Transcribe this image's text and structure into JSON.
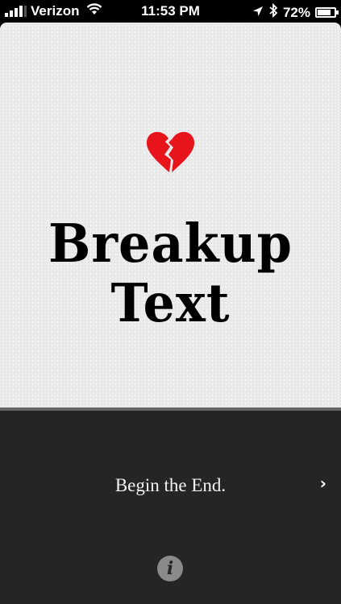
{
  "status_bar": {
    "carrier": "Verizon",
    "time": "11:53 PM",
    "battery_percent": "72%",
    "battery_level": 0.72,
    "signal_bars": 4,
    "icons": [
      "signal-icon",
      "wifi-icon",
      "location-icon",
      "bluetooth-icon",
      "battery-icon"
    ]
  },
  "splash": {
    "title_line_1": "Breakup",
    "title_line_2": "Text",
    "logo_icon": "broken-heart-icon",
    "logo_color": "#e8141b"
  },
  "bottom_panel": {
    "begin_label": "Begin the End.",
    "chevron": "›",
    "info_label": "i",
    "background_color": "#252525"
  }
}
